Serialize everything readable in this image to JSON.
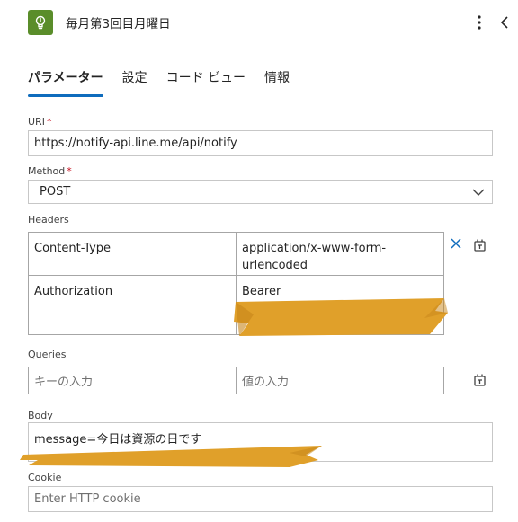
{
  "header": {
    "title": "毎月第3回目月曜日",
    "app_icon": "lightbulb-icon",
    "brand_color": "#5a8d2a"
  },
  "tabs": [
    {
      "label": "パラメーター",
      "active": true
    },
    {
      "label": "設定",
      "active": false
    },
    {
      "label": "コード ビュー",
      "active": false
    },
    {
      "label": "情報",
      "active": false
    }
  ],
  "uri": {
    "label": "URI",
    "required_mark": "*",
    "value": "https://notify-api.line.me/api/notify"
  },
  "method": {
    "label": "Method",
    "required_mark": "*",
    "value": "POST"
  },
  "headers": {
    "label": "Headers",
    "rows": [
      {
        "key": "Content-Type",
        "value": "application/x-www-form-urlencoded"
      },
      {
        "key": "Authorization",
        "value": "Bearer"
      }
    ]
  },
  "queries": {
    "label": "Queries",
    "key_placeholder": "キーの入力",
    "value_placeholder": "値の入力"
  },
  "body": {
    "label": "Body",
    "value": "message=今日は資源の日です"
  },
  "cookie": {
    "label": "Cookie",
    "placeholder": "Enter HTTP cookie"
  },
  "colors": {
    "accent": "#0f6cbd",
    "required": "#c50f1f",
    "redaction": "#e0a02a"
  }
}
